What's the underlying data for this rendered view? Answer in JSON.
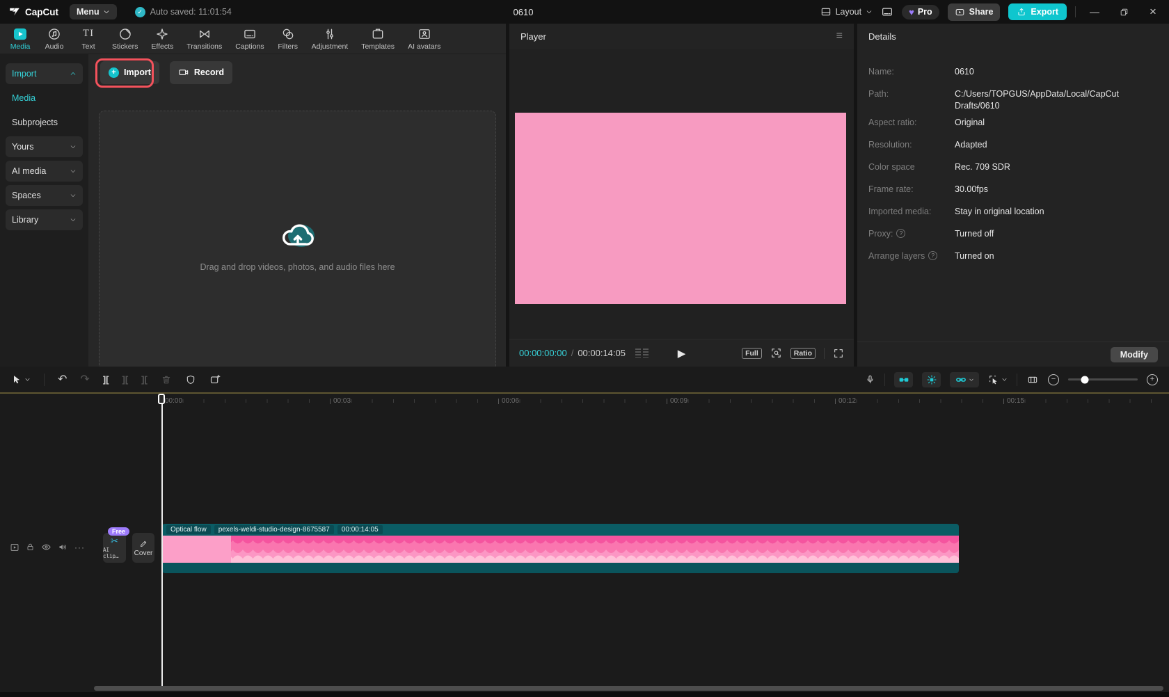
{
  "icons": {
    "plus": "+",
    "check": "✓",
    "close": "×",
    "minimize": "—",
    "hamburger": "≡",
    "undo": "↶",
    "redo": "↷",
    "split": "][",
    "ellipsis": "···",
    "info": "?",
    "play": "▶",
    "text_tool": "TI",
    "pro_gem": "♥",
    "zoom_in": "+",
    "zoom_out": "−",
    "scissors": "✂"
  },
  "titlebar": {
    "brand": "CapCut",
    "menu_label": "Menu",
    "autosave_text": "Auto saved: 11:01:54",
    "project_title": "0610",
    "layout_label": "Layout",
    "pro_label": "Pro",
    "share_label": "Share",
    "export_label": "Export"
  },
  "media_tabs": [
    {
      "label": "Media",
      "active": true
    },
    {
      "label": "Audio"
    },
    {
      "label": "Text"
    },
    {
      "label": "Stickers"
    },
    {
      "label": "Effects"
    },
    {
      "label": "Transitions"
    },
    {
      "label": "Captions"
    },
    {
      "label": "Filters"
    },
    {
      "label": "Adjustment"
    },
    {
      "label": "Templates"
    },
    {
      "label": "AI avatars"
    }
  ],
  "sidebar": {
    "items": [
      {
        "label": "Import",
        "state": "expanded-active"
      },
      {
        "label": "Media",
        "state": "selected"
      },
      {
        "label": "Subprojects",
        "state": "normal"
      },
      {
        "label": "Yours",
        "state": "collapsed"
      },
      {
        "label": "AI media",
        "state": "collapsed"
      },
      {
        "label": "Spaces",
        "state": "collapsed"
      },
      {
        "label": "Library",
        "state": "collapsed"
      }
    ]
  },
  "media_panel": {
    "import_label": "Import",
    "record_label": "Record",
    "dropzone_text": "Drag and drop videos, photos, and audio files here"
  },
  "player": {
    "title": "Player",
    "current_time": "00:00:00:00",
    "separator": "/",
    "duration": "00:00:14:05",
    "full_label": "Full",
    "ratio_label": "Ratio"
  },
  "details": {
    "title": "Details",
    "rows": [
      {
        "label": "Name:",
        "value": "0610"
      },
      {
        "label": "Path:",
        "value": "C:/Users/TOPGUS/AppData/Local/CapCut Drafts/0610"
      },
      {
        "label": "Aspect ratio:",
        "value": "Original"
      },
      {
        "label": "Resolution:",
        "value": "Adapted"
      },
      {
        "label": "Color space",
        "value": "Rec. 709 SDR"
      },
      {
        "label": "Frame rate:",
        "value": "30.00fps"
      },
      {
        "label": "Imported media:",
        "value": "Stay in original location"
      },
      {
        "label": "Proxy:",
        "value": "Turned off",
        "info": true
      },
      {
        "label": "Arrange layers",
        "value": "Turned on",
        "info": true
      }
    ],
    "modify_label": "Modify"
  },
  "timeline": {
    "ruler_labels": [
      "00:00",
      "00:03",
      "00:06",
      "00:09",
      "00:12",
      "00:15"
    ],
    "clip": {
      "badges": [
        "Optical flow",
        "pexels-weldi-studio-design-8675587",
        "00:00:14:05"
      ]
    },
    "ai_clip_label": "AI clip…",
    "ai_clip_badge": "Free",
    "cover_label": "Cover"
  },
  "colors": {
    "accent_teal": "#2fd0d8",
    "export_teal": "#0fc6ce",
    "preview_pink": "#f79bc1",
    "clip_teal": "#0b5c64",
    "annotation_red": "#f3525c",
    "free_badge_purple": "#9d7bfb"
  }
}
